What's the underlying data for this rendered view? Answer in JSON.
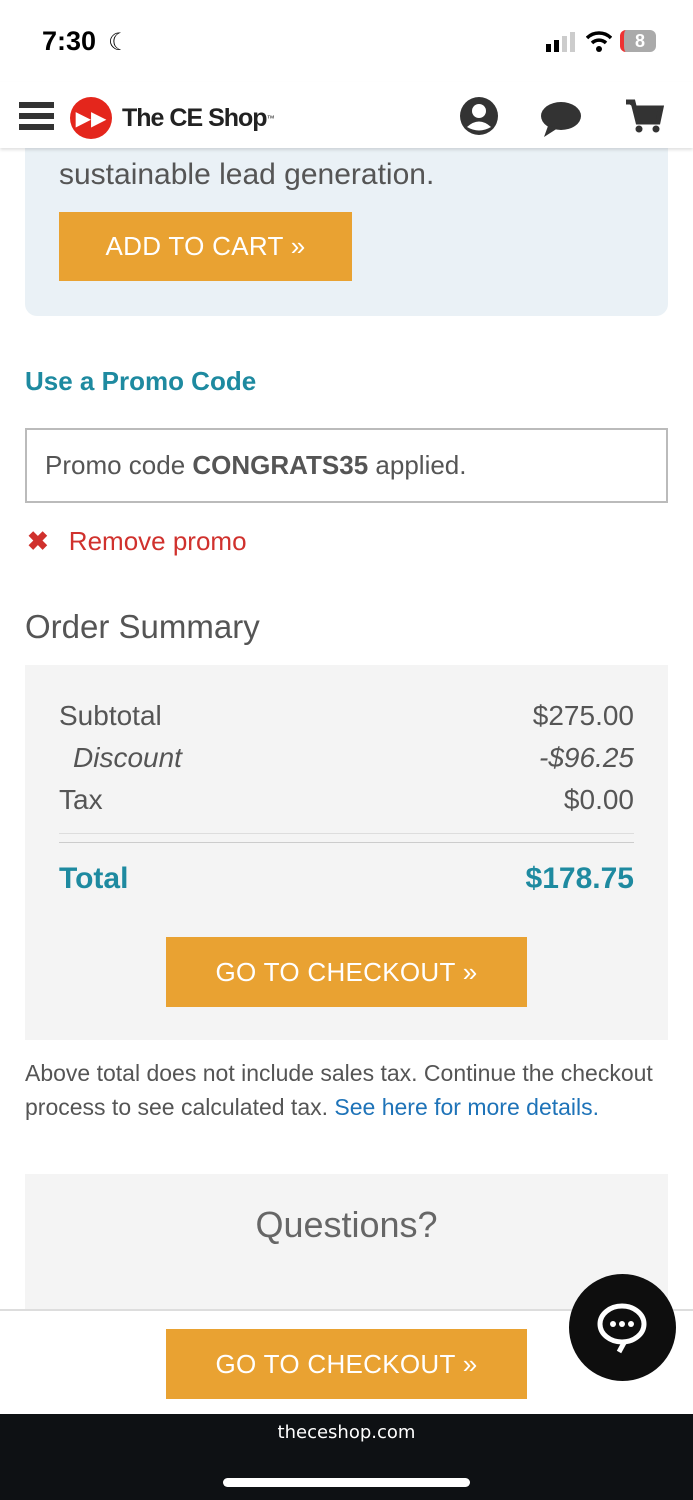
{
  "status": {
    "time": "7:30",
    "battery": "8"
  },
  "header": {
    "logo_text": "The CE Shop",
    "tm": "™"
  },
  "promo_card": {
    "text": "sustainable lead generation.",
    "add_to_cart": "ADD TO CART »"
  },
  "promo": {
    "heading": "Use a Promo Code",
    "prefix": "Promo code ",
    "code": "CONGRATS35",
    "suffix": " applied.",
    "remove": "Remove promo"
  },
  "summary": {
    "title": "Order Summary",
    "rows": [
      {
        "label": "Subtotal",
        "value": "$275.00"
      },
      {
        "label": "Discount",
        "value": "-$96.25"
      },
      {
        "label": "Tax",
        "value": "$0.00"
      }
    ],
    "total_label": "Total",
    "total_value": "$178.75",
    "checkout": "GO TO CHECKOUT »"
  },
  "note": {
    "text": "Above total does not include sales tax. Continue the checkout process to see calculated tax. ",
    "link": "See here for more details."
  },
  "questions": {
    "title": "Questions?"
  },
  "sticky": {
    "checkout": "GO TO CHECKOUT »"
  },
  "browser": {
    "url": "theceshop.com"
  },
  "colors": {
    "accent": "#e9a232",
    "teal": "#1e8aa0",
    "remove": "#d0312d",
    "logo": "#e4261c"
  }
}
